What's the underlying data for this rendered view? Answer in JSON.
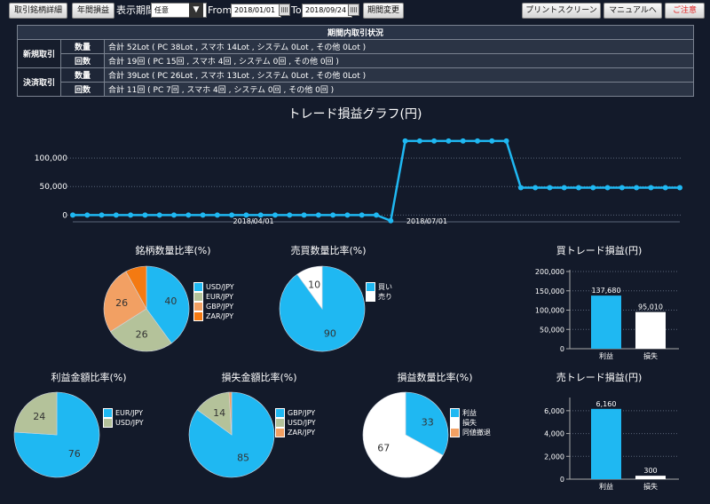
{
  "toolbar": {
    "btn_detail": "取引銘柄詳細",
    "btn_yearly": "年間損益",
    "period_label": "表示期間",
    "period_value": "任意",
    "from_label": "From",
    "from_date": "2018/01/01",
    "to_label": "To",
    "to_date": "2018/09/24",
    "btn_change": "期間変更",
    "btn_print": "プリントスクリーン",
    "btn_manual": "マニュアルへ",
    "btn_close": "ご注意"
  },
  "summary": {
    "header": "期間内取引状況",
    "groups": [
      {
        "name": "新規取引",
        "rows": [
          {
            "label": "数量",
            "value": "合計 52Lot ( PC 38Lot , スマホ 14Lot , システム 0Lot , その他 0Lot )"
          },
          {
            "label": "回数",
            "value": "合計 19回 ( PC 15回 , スマホ 4回 , システム 0回 , その他 0回 )"
          }
        ]
      },
      {
        "name": "決済取引",
        "rows": [
          {
            "label": "数量",
            "value": "合計 39Lot ( PC 26Lot , スマホ 13Lot , システム 0Lot , その他 0Lot )"
          },
          {
            "label": "回数",
            "value": "合計 11回 ( PC 7回 , スマホ 4回 , システム 0回 , その他 0回 )"
          }
        ]
      }
    ]
  },
  "colors": {
    "accent": "#1fb8f2",
    "olive": "#b4c29a",
    "orange": "#f2a063",
    "darkorange": "#f47a12",
    "white": "#ffffff",
    "background": "#131a2a"
  },
  "chart_data": [
    {
      "id": "line",
      "type": "line",
      "title": "トレード損益グラフ(円)",
      "yticks": [
        0,
        50000,
        100000
      ],
      "ytick_labels": [
        "0",
        "50,000",
        "100,000"
      ],
      "ylim": [
        -15000,
        150000
      ],
      "xtick_labels": [
        "2018/04/01",
        "2018/07/01"
      ],
      "xtick_index": [
        12.5,
        24.5
      ],
      "values": [
        0,
        0,
        0,
        0,
        0,
        0,
        0,
        0,
        0,
        0,
        0,
        0,
        0,
        0,
        0,
        0,
        0,
        0,
        0,
        0,
        0,
        0,
        -10000,
        130000,
        130000,
        130000,
        130000,
        130000,
        130000,
        130000,
        130000,
        48000,
        48000,
        48000,
        48000,
        48000,
        48000,
        48000,
        48000,
        48000,
        48000,
        48000,
        48000
      ]
    },
    {
      "id": "pie1",
      "type": "pie",
      "title": "銘柄数量比率(%)",
      "labels": [
        "USD/JPY",
        "EUR/JPY",
        "GBP/JPY",
        "ZAR/JPY"
      ],
      "values": [
        40,
        26,
        26,
        8
      ],
      "shown": [
        "40",
        "26",
        "26",
        ""
      ],
      "colors": [
        "#1fb8f2",
        "#b4c29a",
        "#f2a063",
        "#f47a12"
      ]
    },
    {
      "id": "pie2",
      "type": "pie",
      "title": "売買数量比率(%)",
      "labels": [
        "買い",
        "売り"
      ],
      "values": [
        90,
        10
      ],
      "shown": [
        "90",
        "10"
      ],
      "colors": [
        "#1fb8f2",
        "#ffffff"
      ]
    },
    {
      "id": "bar1",
      "type": "bar",
      "title": "買トレード損益(円)",
      "categories": [
        "利益",
        "損失"
      ],
      "values": [
        137680,
        95010
      ],
      "value_labels": [
        "137,680",
        "95,010"
      ],
      "colors": [
        "#1fb8f2",
        "#ffffff"
      ],
      "yticks": [
        0,
        50000,
        100000,
        150000,
        200000
      ],
      "ytick_labels": [
        "0",
        "50,000",
        "100,000",
        "150,000",
        "200,000"
      ],
      "ylim": [
        0,
        200000
      ]
    },
    {
      "id": "pie3",
      "type": "pie",
      "title": "利益金額比率(%)",
      "labels": [
        "EUR/JPY",
        "USD/JPY"
      ],
      "values": [
        76,
        24
      ],
      "shown": [
        "76",
        "24"
      ],
      "colors": [
        "#1fb8f2",
        "#b4c29a"
      ]
    },
    {
      "id": "pie4",
      "type": "pie",
      "title": "損失金額比率(%)",
      "labels": [
        "GBP/JPY",
        "USD/JPY",
        "ZAR/JPY"
      ],
      "values": [
        85,
        14,
        1
      ],
      "shown": [
        "85",
        "14",
        ""
      ],
      "colors": [
        "#1fb8f2",
        "#b4c29a",
        "#f2a063"
      ]
    },
    {
      "id": "pie5",
      "type": "pie",
      "title": "損益数量比率(%)",
      "labels": [
        "利益",
        "損失",
        "同値撤退"
      ],
      "values": [
        33,
        67,
        0
      ],
      "shown": [
        "33",
        "67",
        ""
      ],
      "colors": [
        "#1fb8f2",
        "#ffffff",
        "#f2a063"
      ]
    },
    {
      "id": "bar2",
      "type": "bar",
      "title": "売トレード損益(円)",
      "categories": [
        "利益",
        "損失"
      ],
      "values": [
        6160,
        300
      ],
      "value_labels": [
        "6,160",
        "300"
      ],
      "colors": [
        "#1fb8f2",
        "#ffffff"
      ],
      "yticks": [
        0,
        2000,
        4000,
        6000
      ],
      "ytick_labels": [
        "0",
        "2,000",
        "4,000",
        "6,000"
      ],
      "ylim": [
        0,
        7000
      ]
    }
  ]
}
